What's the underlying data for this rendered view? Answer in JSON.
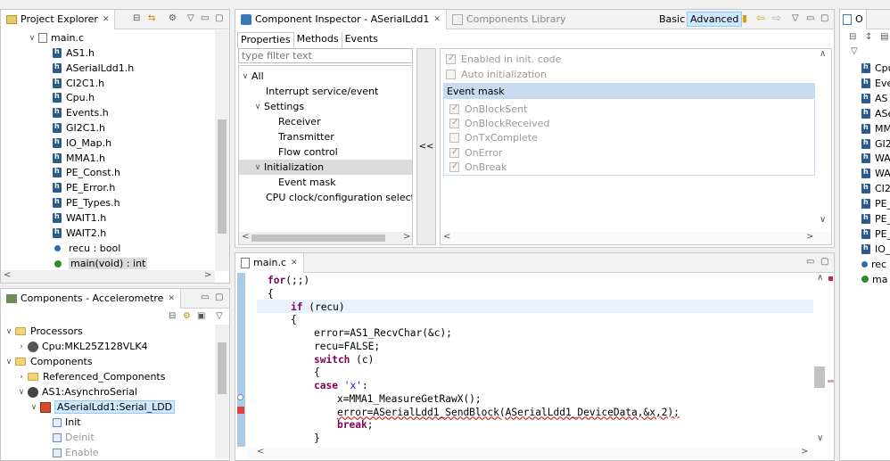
{
  "project_explorer": {
    "title": "Project Explorer",
    "root": "main.c",
    "items": [
      "AS1.h",
      "ASerialLdd1.h",
      "CI2C1.h",
      "Cpu.h",
      "Events.h",
      "GI2C1.h",
      "IO_Map.h",
      "MMA1.h",
      "PE_Const.h",
      "PE_Error.h",
      "PE_Types.h",
      "WAIT1.h",
      "WAIT2.h"
    ],
    "var_item": "recu : bool",
    "func_item": "main(void) : int"
  },
  "components": {
    "title": "Components - Accelerometre",
    "processors": "Processors",
    "cpu": "Cpu:MKL25Z128VLK4",
    "components_label": "Components",
    "referenced": "Referenced_Components",
    "as1": "AS1:AsynchroSerial",
    "serial_ldd": "ASerialLdd1:Serial_LDD",
    "methods": [
      "Init",
      "Deinit",
      "Enable"
    ]
  },
  "inspector": {
    "title": "Component Inspector - ASerialLdd1",
    "library_tab": "Components Library",
    "basic": "Basic",
    "advanced": "Advanced",
    "tabs": [
      "Properties",
      "Methods",
      "Events"
    ],
    "filter_placeholder": "type filter text",
    "tree": {
      "all": "All",
      "interrupt": "Interrupt service/event",
      "settings": "Settings",
      "receiver": "Receiver",
      "transmitter": "Transmitter",
      "flow": "Flow control",
      "initialization": "Initialization",
      "event_mask": "Event mask",
      "cpu_clock": "CPU clock/configuration selection"
    },
    "collapse_btn": "<<",
    "enabled_init": "Enabled in init. code",
    "auto_init": "Auto initialization",
    "event_mask_header": "Event mask",
    "events": [
      "OnBlockSent",
      "OnBlockReceived",
      "OnTxComplete",
      "OnError",
      "OnBreak"
    ],
    "events_checked": [
      true,
      true,
      false,
      true,
      true
    ]
  },
  "editor": {
    "tab": "main.c",
    "lines": [
      "for(;;)",
      "{",
      "if (recu)",
      "{",
      "error=AS1_RecvChar(&c);",
      "recu=FALSE;",
      "switch (c)",
      "{",
      "case 'x':",
      "x=MMA1_MeasureGetRawX();",
      "error=ASerialLdd1_SendBlock(ASerialLdd1_DeviceData,&x,2);",
      "break;",
      "}"
    ]
  },
  "outline": {
    "tab": "O",
    "items": [
      "Cpu",
      "Eve",
      "AS",
      "ASe",
      "MM",
      "GI2",
      "WA",
      "WA",
      "CI2",
      "PE_",
      "PE_",
      "PE_",
      "IO_",
      "rec",
      "ma"
    ]
  },
  "colors": {
    "selection": "#cde8ff",
    "event_header": "#c7dcef",
    "keyword": "#7f0055",
    "string": "#2a00ff",
    "current_line": "#e8f2fe"
  }
}
